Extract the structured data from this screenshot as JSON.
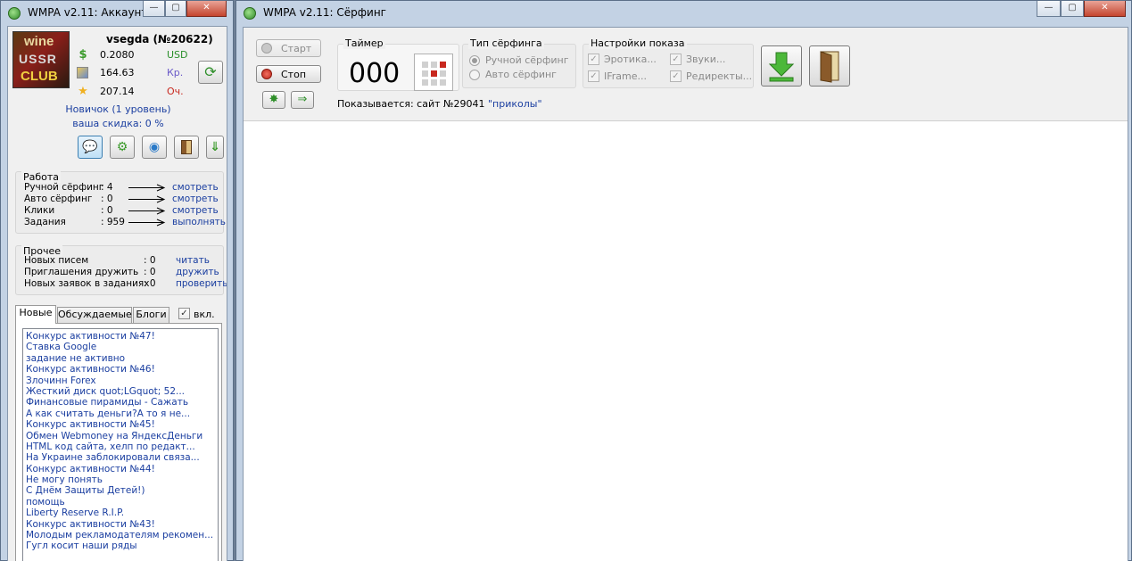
{
  "left_window": {
    "title": "WMPA v2.11: Аккаунт",
    "avatar_text": [
      "wine",
      "USSR",
      "CLUB"
    ],
    "username": "vsegda (№20622)",
    "balances": [
      {
        "icon": "dollar-icon",
        "value": "0.2080",
        "unit": "USD",
        "unit_color": "#2a8f2a"
      },
      {
        "icon": "credit-icon",
        "value": "164.63",
        "unit": "Кр.",
        "unit_color": "#6a5ac8"
      },
      {
        "icon": "star-icon",
        "value": "207.14",
        "unit": "Оч.",
        "unit_color": "#c8281e"
      }
    ],
    "level": "Новичок (1 уровень)",
    "discount": "ваша скидка: 0 %",
    "work": {
      "title": "Работа",
      "rows": [
        {
          "label": "Ручной сёрфинг",
          "count": ": 4",
          "action": "смотреть"
        },
        {
          "label": "Авто сёрфинг",
          "count": ": 0",
          "action": "смотреть"
        },
        {
          "label": "Клики",
          "count": ": 0",
          "action": "смотреть"
        },
        {
          "label": "Задания",
          "count": ": 959",
          "action": "выполнять"
        }
      ]
    },
    "other": {
      "title": "Прочее",
      "rows": [
        {
          "label": "Новых писем",
          "count": ": 0",
          "action": "читать"
        },
        {
          "label": "Приглашения дружить",
          "count": ": 0",
          "action": "дружить"
        },
        {
          "label": "Новых заявок в заданиях",
          "count": ": 0",
          "action": "проверить"
        }
      ]
    },
    "tabs": [
      "Новые",
      "Обсуждаемые",
      "Блоги"
    ],
    "enabled_label": "вкл.",
    "enabled_checked": true,
    "news": [
      "Конкурс активности №47!",
      "Ставка Google",
      "задание не активно",
      "Конкурс активности №46!",
      "Злочинн  Forex",
      "Жесткий диск quot;LGquot; 52...",
      "Финансовые пирамиды - Сажать",
      "А как считать деньги?А то я не...",
      "Конкурс активности №45!",
      "Обмен Webmoney на ЯндексДеньги",
      "HTML код сайта, хелп по редакт...",
      "На Украине заблокировали связа...",
      "Конкурс активности №44!",
      "Не могу понять",
      "С Днём Защиты Детей!)",
      "помощь",
      "Liberty Reserve R.I.P.",
      "Конкурс активности №43!",
      "Молодым  рекламодателям  рекомен...",
      "Гугл косит наши ряды"
    ]
  },
  "right_window": {
    "title": "WMPA v2.11: Сёрфинг",
    "start_label": "Старт",
    "stop_label": "Стоп",
    "timer": {
      "title": "Таймер",
      "value": "000"
    },
    "surf_type": {
      "title": "Тип сёрфинга",
      "options": [
        "Ручной сёрфинг",
        "Авто сёрфинг"
      ],
      "selected": "Ручной сёрфинг"
    },
    "display_settings": {
      "title": "Настройки показа",
      "options": [
        "Эротика...",
        "Звуки...",
        "IFrame...",
        "Редиректы..."
      ]
    },
    "status": {
      "prefix": "Показывается: сайт №29041 ",
      "site": "\"приколы\""
    }
  },
  "colors": {
    "link": "#1a3ea0",
    "titlebar": "#c3d2e4",
    "close": "#c4452f"
  }
}
